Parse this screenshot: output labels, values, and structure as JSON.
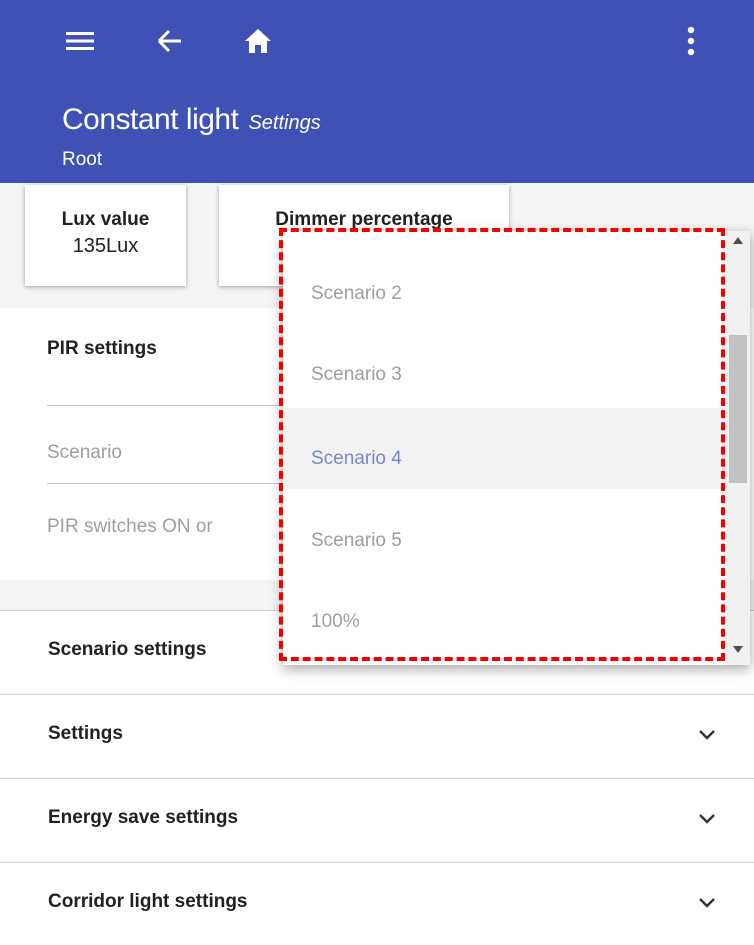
{
  "appbar": {
    "title": "Constant light",
    "subtitle": "Settings",
    "breadcrumb": "Root",
    "background_color": "#3f51b5",
    "icons": [
      "menu-icon",
      "back-arrow-icon",
      "home-icon",
      "more-vert-icon"
    ]
  },
  "cards": {
    "lux": {
      "label": "Lux value",
      "value": "135Lux"
    },
    "dimmer": {
      "label": "Dimmer percentage"
    }
  },
  "pir_panel": {
    "title": "PIR settings",
    "scenario_label": "Scenario",
    "pir_switch_label": "PIR switches ON or"
  },
  "sections": [
    {
      "label": "Scenario settings"
    },
    {
      "label": "Settings"
    },
    {
      "label": "Energy save settings"
    },
    {
      "label": "Corridor light settings"
    }
  ],
  "dropdown": {
    "options": [
      "Scenario 2",
      "Scenario 3",
      "Scenario 4",
      "Scenario 5",
      "100%"
    ],
    "selected": "Scenario 4",
    "selected_color": "#7986cb",
    "highlight_color": "#f50000"
  }
}
